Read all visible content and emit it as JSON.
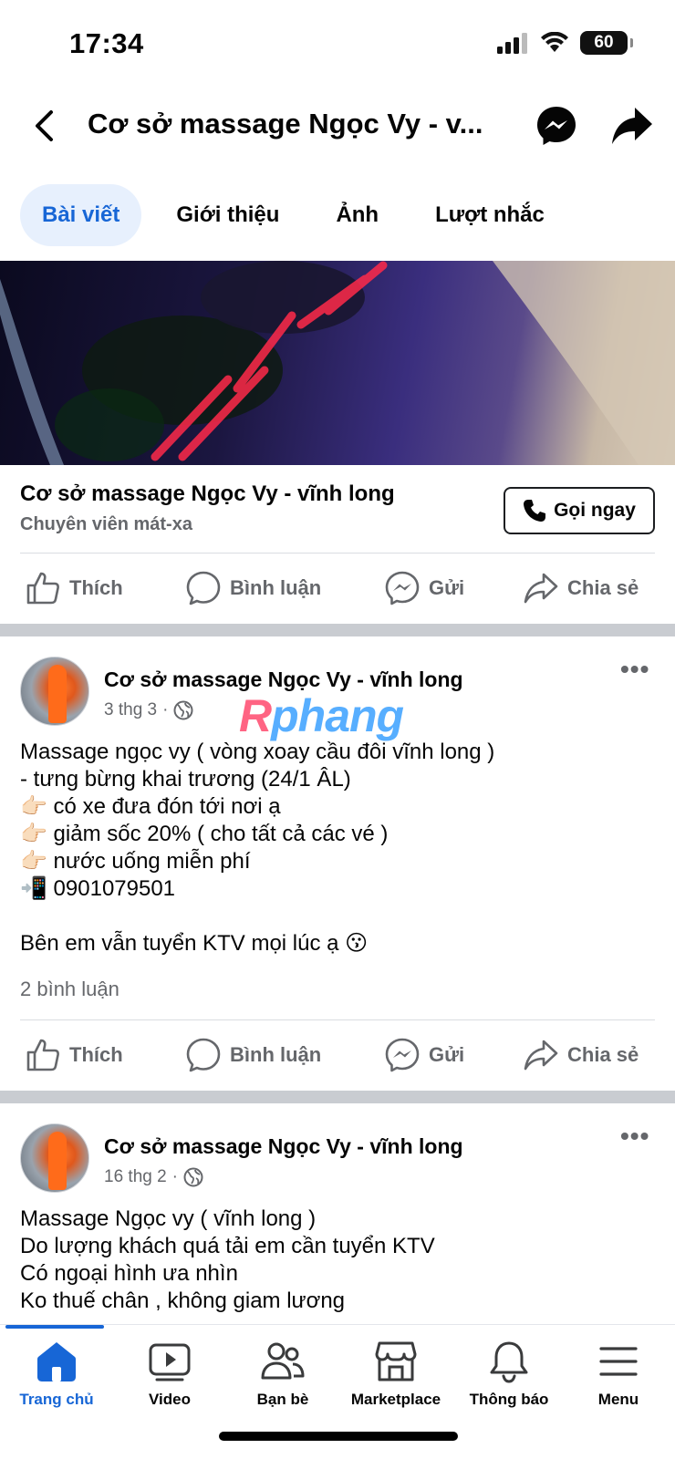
{
  "status": {
    "time": "17:34",
    "battery": "60"
  },
  "header": {
    "title": "Cơ sở massage Ngọc Vy - v..."
  },
  "tabs": [
    {
      "label": "Bài viết",
      "active": true
    },
    {
      "label": "Giới thiệu",
      "active": false
    },
    {
      "label": "Ảnh",
      "active": false
    },
    {
      "label": "Lượt nhắc",
      "active": false
    }
  ],
  "page": {
    "name": "Cơ sở massage Ngọc Vy - vĩnh long",
    "category": "Chuyên viên mát-xa",
    "call_button": "Gọi ngay"
  },
  "actions": {
    "like": "Thích",
    "comment": "Bình luận",
    "send": "Gửi",
    "share": "Chia sẻ"
  },
  "watermark": "Rphang",
  "posts": [
    {
      "author": "Cơ sở massage Ngọc Vy - vĩnh long",
      "date": "3 thg 3",
      "lines": [
        "Massage ngọc vy ( vòng xoay cầu đôi vĩnh long )",
        "- tưng bừng khai trương (24/1 ÂL)",
        "👉🏻 có xe đưa đón tới nơi ạ",
        "👉🏻 giảm sốc 20% ( cho tất cả các vé )",
        "👉🏻 nước uống miễn phí",
        "📲 0901079501",
        "",
        "Bên em vẫn tuyển KTV mọi lúc ạ 😗"
      ],
      "comments": "2 bình luận"
    },
    {
      "author": "Cơ sở massage Ngọc Vy - vĩnh long",
      "date": "16 thg 2",
      "lines": [
        "Massage Ngọc vy ( vĩnh long )",
        "Do lượng khách quá tải em cần tuyển KTV",
        "Có ngoại hình ưa nhìn",
        "Ko thuế chân , không giam lương"
      ]
    }
  ],
  "bottom_nav": [
    {
      "label": "Trang chủ",
      "icon": "home-icon",
      "active": true
    },
    {
      "label": "Video",
      "icon": "video-icon",
      "active": false
    },
    {
      "label": "Bạn bè",
      "icon": "friends-icon",
      "active": false
    },
    {
      "label": "Marketplace",
      "icon": "marketplace-icon",
      "active": false
    },
    {
      "label": "Thông báo",
      "icon": "bell-icon",
      "active": false
    },
    {
      "label": "Menu",
      "icon": "menu-icon",
      "active": false
    }
  ],
  "colors": {
    "accent": "#1766d6",
    "muted": "#65676b",
    "tab_active_bg": "#e7f0fd"
  }
}
